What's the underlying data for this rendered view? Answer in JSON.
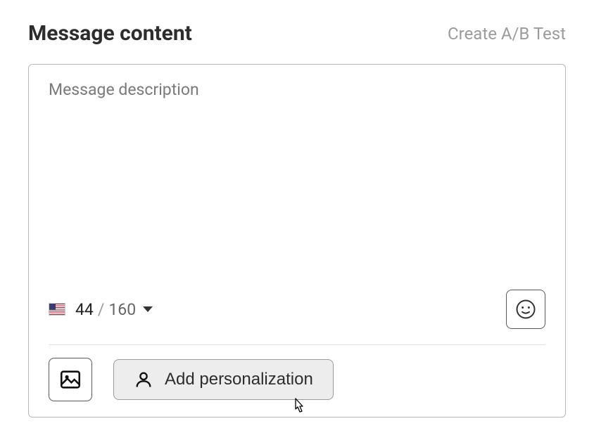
{
  "header": {
    "title": "Message content",
    "ab_test_link": "Create A/B Test"
  },
  "editor": {
    "placeholder": "Message description",
    "counter": {
      "flag_country": "us",
      "current": "44",
      "separator": "/",
      "max": "160"
    },
    "emoji_button": "emoji",
    "image_button": "image",
    "personalization_button": "Add personalization"
  }
}
